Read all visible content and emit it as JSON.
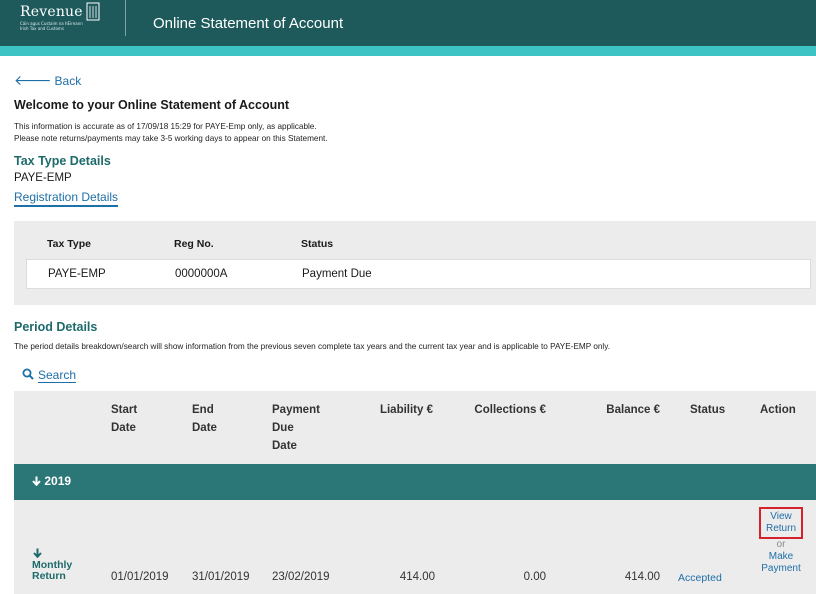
{
  "header": {
    "logo_text": "Revenue",
    "logo_subtext": "Cáin agus Custaim na hÉireann Irish Tax and Customs",
    "title": "Online Statement of Account"
  },
  "nav": {
    "back_label": "Back"
  },
  "welcome": {
    "title": "Welcome to your Online Statement of Account",
    "info_line1": "This information is accurate as of 17/09/18 15:29 for PAYE-Emp only, as applicable.",
    "info_line2": "Please note returns/payments may take 3-5 working days to appear on this Statement."
  },
  "tax_type": {
    "heading": "Tax Type Details",
    "value": "PAYE-EMP",
    "registration_link": "Registration Details"
  },
  "registration": {
    "columns": [
      "Tax Type",
      "Reg No.",
      "Status"
    ],
    "row": {
      "tax_type": "PAYE-EMP",
      "reg_no": "0000000A",
      "status": "Payment Due"
    }
  },
  "period": {
    "heading": "Period Details",
    "description": "The period details breakdown/search will show information from the previous seven complete tax years and the current tax year and is applicable to PAYE-EMP only.",
    "search_label": "Search",
    "columns": {
      "start_date": [
        "Start",
        "Date"
      ],
      "end_date": [
        "End",
        "Date"
      ],
      "payment_due_date": [
        "Payment",
        "Due",
        "Date"
      ],
      "liability": "Liability €",
      "collections": "Collections €",
      "balance": "Balance €",
      "status": "Status",
      "action": "Action"
    },
    "year_group": {
      "label": "2019"
    },
    "row": {
      "type_line1": "Monthly",
      "type_line2": "Return",
      "start_date": "01/01/2019",
      "end_date": "31/01/2019",
      "payment_due_date": "23/02/2019",
      "liability": "414.00",
      "collections": "0.00",
      "balance": "414.00",
      "status": "Accepted",
      "action_view_1": "View",
      "action_view_2": "Return",
      "action_or": "or",
      "action_pay_1": "Make",
      "action_pay_2": "Payment"
    }
  },
  "colors": {
    "header_bg": "#1e5a5c",
    "accent_stripe": "#3ec3c5",
    "link": "#1f6fa8",
    "year_bar": "#2b7676",
    "highlight_box": "#d4232b"
  }
}
